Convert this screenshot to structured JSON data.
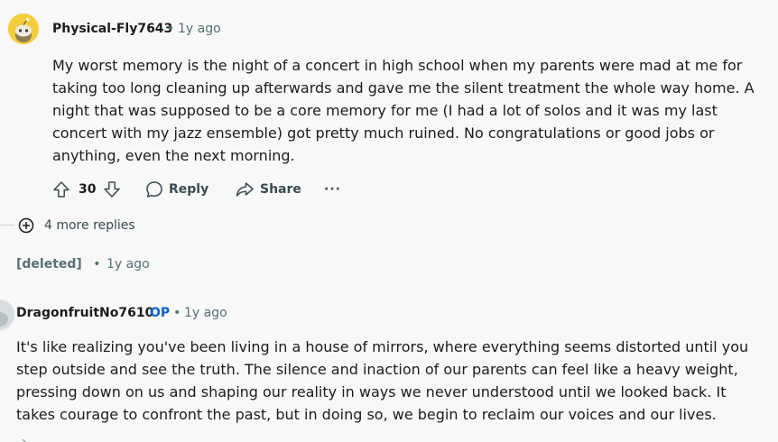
{
  "comment1": {
    "author": "Physical-Fly7643",
    "separator": "•",
    "time": "1y ago",
    "body": "My worst memory is the night of a concert in high school when my parents were mad at me for taking too long cleaning up afterwards and gave me the silent treatment the whole way home. A night that was supposed to be a core memory for me (I had a lot of solos and it was my last concert with my jazz ensemble) got pretty much ruined. No congratulations or good jobs or anything, even the next morning.",
    "votes": "30",
    "reply_label": "Reply",
    "share_label": "Share",
    "more_label": "···"
  },
  "more_replies": {
    "label": "4 more replies"
  },
  "deleted_comment": {
    "author": "[deleted]",
    "separator": "•",
    "time": "1y ago"
  },
  "comment2": {
    "author": "DragonfruitNo7610",
    "op_badge": "OP",
    "separator": "•",
    "time": "1y ago",
    "body": "It's like realizing you've been living in a house of mirrors, where everything seems distorted until you step outside and see the truth. The silence and inaction of our parents can feel like a heavy weight, pressing down on us and shaping our reality in ways we never understood until we looked back. It takes courage to confront the past, but in doing so, we begin to reclaim our voices and our lives."
  },
  "icons": {
    "upvote": "upvote-arrow-icon",
    "downvote": "downvote-arrow-icon",
    "reply": "speech-bubble-icon",
    "share": "share-arrow-icon",
    "expand": "plus-circle-icon",
    "avatar": "snoo-avatar-icon"
  },
  "colors": {
    "background": "#f8f8f8",
    "text": "#1c1c1c",
    "meta": "#576f76",
    "op": "#0a62c7",
    "avatar1": "#f3cd3d"
  }
}
